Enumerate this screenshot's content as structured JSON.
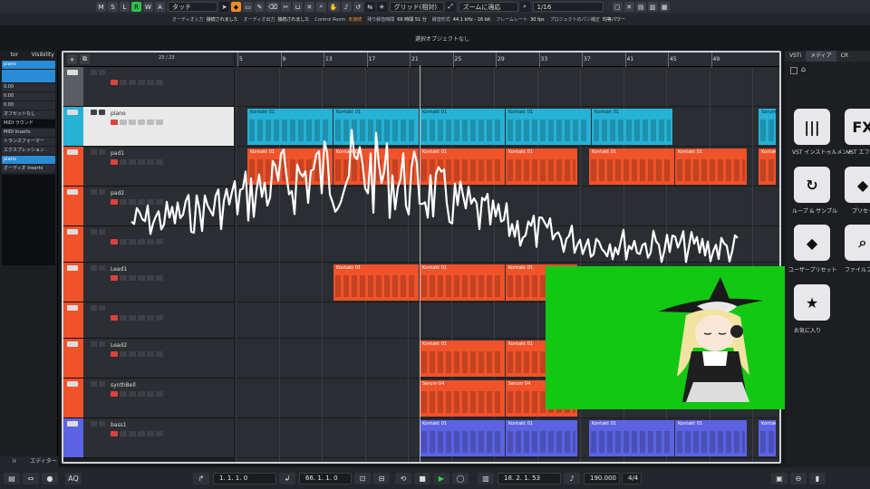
{
  "toolbar": {
    "buttons": [
      "M",
      "S",
      "L",
      "R",
      "W",
      "A"
    ],
    "mode_select": "タッチ",
    "grid_select": "グリッド(相対)",
    "zoom_select": "ズームに適応",
    "quantize_select": "1/16"
  },
  "infobar": [
    {
      "label": "オーディオ入力",
      "value": "接続されました",
      "color": "w"
    },
    {
      "label": "オーディオ出力",
      "value": "接続されました",
      "color": "w"
    },
    {
      "label": "Control Room",
      "value": "未接続",
      "color": "v"
    },
    {
      "label": "残り録音時間",
      "value": "66 時間 51 分",
      "color": "w"
    },
    {
      "label": "録音形式",
      "value": "44.1 kHz - 16 bit",
      "color": "w"
    },
    {
      "label": "フレームレート",
      "value": "30 fps",
      "color": "w"
    },
    {
      "label": "プロジェクトのパン補正",
      "value": "均等パワー",
      "color": "w"
    }
  ],
  "status_line": "選択オブジェクトなし",
  "inspector": {
    "tabs": [
      "tor",
      "Visibility"
    ],
    "rows": [
      "piano",
      "",
      "0.00",
      "0.00",
      "0.00",
      "オフセットなし",
      "MIDI ラウンド",
      "MIDI Inserts",
      "トランスフォーマー",
      "エクスプレッション",
      "piano",
      "オーディオ Inserts"
    ],
    "bottom_tabs": [
      "ir",
      "エディター"
    ]
  },
  "project": {
    "counter": "23 / 23",
    "ruler": [
      "5",
      "9",
      "13",
      "17",
      "21",
      "25",
      "29",
      "33",
      "37",
      "41",
      "45",
      "49"
    ],
    "tracks": [
      {
        "name": "",
        "color": "#5a5d63",
        "height": 44
      },
      {
        "name": "piano",
        "color": "#25b2d6",
        "height": 44,
        "selected": true
      },
      {
        "name": "pad1",
        "color": "#f0522a",
        "height": 44
      },
      {
        "name": "pad2",
        "color": "#f0522a",
        "height": 44
      },
      {
        "name": "",
        "color": "#f0522a",
        "height": 40
      },
      {
        "name": "Lead1",
        "color": "#f0522a",
        "height": 44
      },
      {
        "name": "",
        "color": "#f0522a",
        "height": 40
      },
      {
        "name": "Lead2",
        "color": "#f0522a",
        "height": 44
      },
      {
        "name": "synthBell",
        "color": "#f0522a",
        "height": 44
      },
      {
        "name": "bass1",
        "color": "#5b63e3",
        "height": 44
      }
    ],
    "part_label_kontakt": "Kontakt 01",
    "part_label_serum": "Serum 04",
    "part_label_serum_short": "Serum"
  },
  "rightzone": {
    "tabs": [
      "VSTi",
      "メディア",
      "CR"
    ],
    "tiles": [
      {
        "icon": "|||",
        "label": "VST インストゥルメント"
      },
      {
        "icon": "FX",
        "label": "VST エフェクト"
      },
      {
        "icon": "↻",
        "label": "ループ & サンプル"
      },
      {
        "icon": "◆",
        "label": "プリセット"
      },
      {
        "icon": "◆",
        "label": "ユーザープリセット"
      },
      {
        "icon": "⌕",
        "label": "ファイルブラウザー"
      },
      {
        "icon": "★",
        "label": "お気に入り"
      }
    ]
  },
  "transport": {
    "left_locator": "1. 1. 1. 0",
    "right_locator": "66. 1. 1. 0",
    "position": "18. 2. 1. 53",
    "tempo": "190.000",
    "signature": "4/4"
  }
}
